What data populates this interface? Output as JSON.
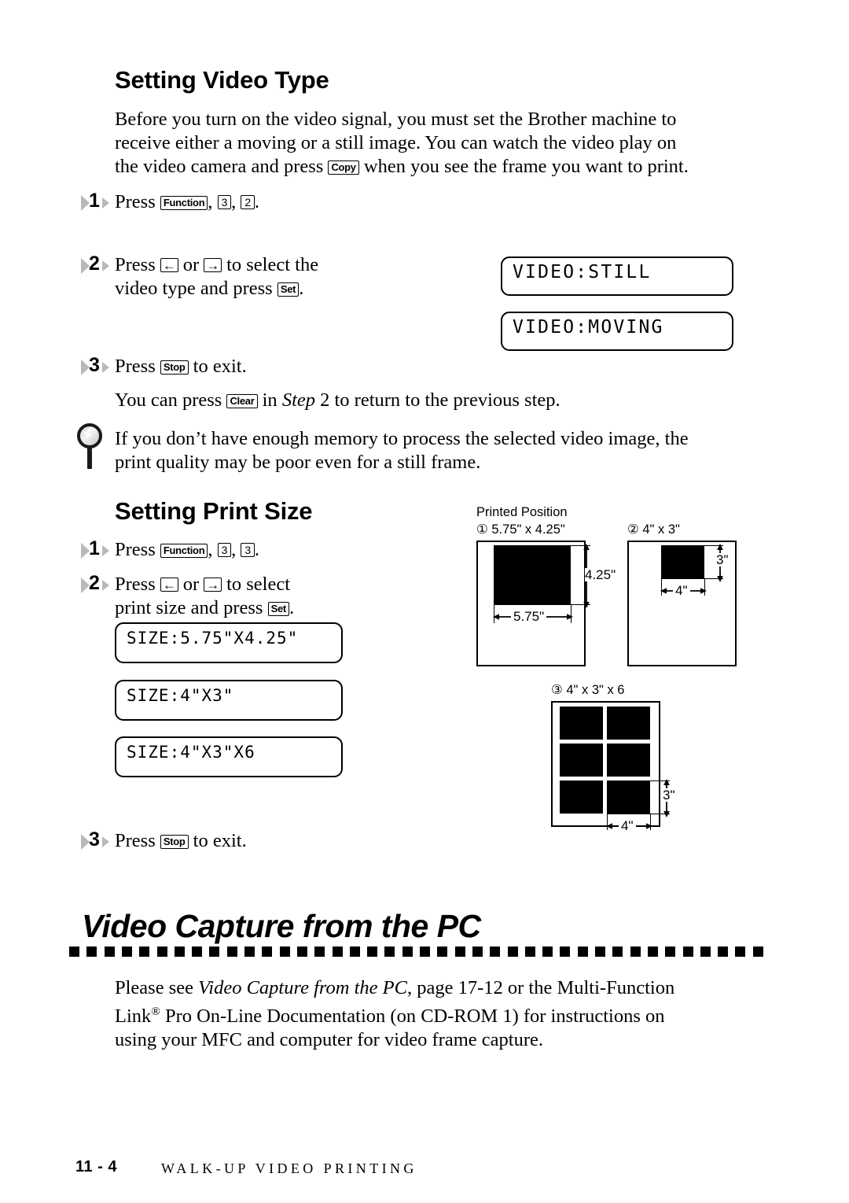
{
  "page": {
    "footer_page_number": "11 - 4",
    "footer_title": "WALK-UP VIDEO PRINTING"
  },
  "section_video_type": {
    "heading": "Setting Video Type",
    "intro_line1": "Before you turn on the video signal, you must set the Brother machine to",
    "intro_line2": "receive either a moving or a still image. You can watch the video play on",
    "intro_line3_a": "the video camera and press",
    "intro_key": "Copy",
    "intro_line3_b": "when you see the frame you want to print.",
    "steps": [
      {
        "number": "1",
        "text_a": "Press",
        "key1": "Function",
        "sep1": ",",
        "key2": "3",
        "sep2": ",",
        "key3": "2",
        "text_b": "."
      },
      {
        "number": "2",
        "line1_a": "Press",
        "key_left": "←",
        "line1_b": "or",
        "key_right": "→",
        "line1_c": "to select the",
        "line2_a": "video type and press",
        "key_set": "Set",
        "line2_b": "."
      },
      {
        "number": "3",
        "text_a": "Press",
        "key_stop": "Stop",
        "text_b": "to exit."
      }
    ],
    "note_a": "You can press",
    "note_key": "Clear",
    "note_b": "in",
    "note_step_italic": "Step",
    "note_c": "2 to return to the previous step.",
    "lcd_still": "VIDEO:STILL",
    "lcd_moving": "VIDEO:MOVING",
    "tip_line1": "If you don’t have enough memory to process the selected video image, the",
    "tip_line2": "print quality may be poor even for a still frame."
  },
  "section_print_size": {
    "heading": "Setting Print Size",
    "steps": [
      {
        "number": "1",
        "text_a": "Press",
        "key1": "Function",
        "sep1": ",",
        "key2": "3",
        "sep2": ",",
        "key3": "3",
        "text_b": "."
      },
      {
        "number": "2",
        "line1_a": "Press",
        "key_left": "←",
        "line1_b": "or",
        "key_right": "→",
        "line1_c": "to select",
        "line2_a": "print size and press",
        "key_set": "Set",
        "line2_b": "."
      },
      {
        "number": "3",
        "text_a": "Press",
        "key_stop": "Stop",
        "text_b": "to exit."
      }
    ],
    "lcd_size1": "SIZE:5.75\"X4.25\"",
    "lcd_size2": "SIZE:4\"X3\"",
    "lcd_size3": "SIZE:4\"X3\"X6"
  },
  "printed_position": {
    "title": "Printed Position",
    "diagram1": {
      "caption": "① 5.75\" x 4.25\"",
      "width_label": "5.75\"",
      "height_label": "4.25\""
    },
    "diagram2": {
      "caption": "② 4\" x 3\"",
      "width_label": "4\"",
      "height_label": "3\""
    },
    "diagram3": {
      "caption": "③ 4\" x 3\" x 6",
      "width_label": "4\"",
      "height_label": "3\""
    }
  },
  "section_video_capture": {
    "heading": "Video Capture from the PC",
    "body_a": "Please see",
    "body_italic": "Video Capture from the PC",
    "body_b": ", page 17-12 or the Multi-Function",
    "body_line2_a": "Link",
    "body_line2_reg": "®",
    "body_line2_b": " Pro On-Line Documentation (on CD-ROM 1) for  instructions on",
    "body_line3": "using your MFC and computer for video frame capture."
  }
}
